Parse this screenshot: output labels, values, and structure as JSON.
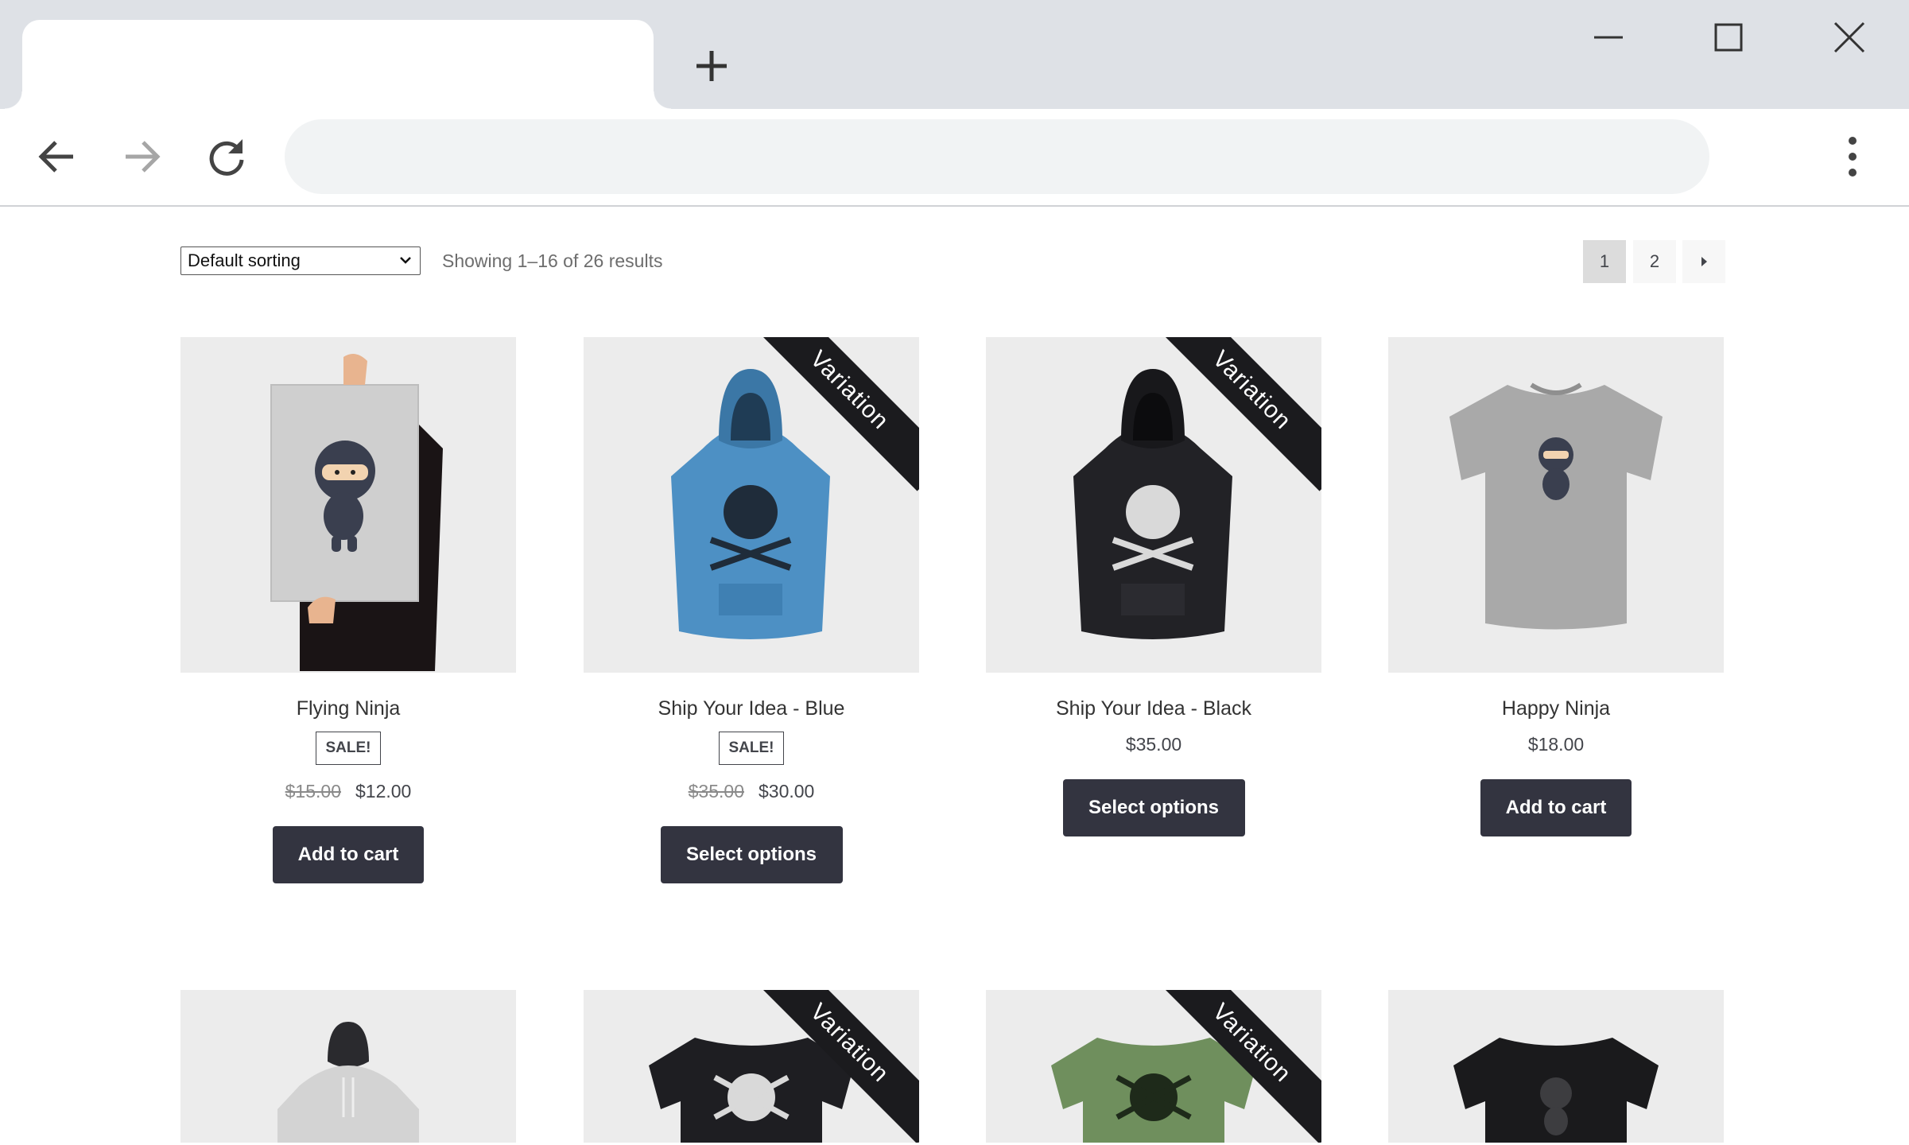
{
  "browser": {
    "icons": {
      "new_tab": "plus-icon",
      "minimize": "minimize-icon",
      "maximize": "maximize-icon",
      "close": "close-icon",
      "back": "back-arrow-icon",
      "forward": "forward-arrow-icon",
      "reload": "reload-icon",
      "menu": "kebab-menu-icon"
    },
    "address": ""
  },
  "shop": {
    "sorting": {
      "selected": "Default sorting"
    },
    "result_count": "Showing 1–16 of 26 results",
    "pagination": {
      "pages": [
        "1",
        "2"
      ],
      "current": "1",
      "next_icon": "next-arrow-icon"
    }
  },
  "products": [
    {
      "name": "Flying Ninja",
      "sale_badge": "SALE!",
      "old_price": "$15.00",
      "price": "$12.00",
      "button": "Add to cart",
      "image": "ninja-poster"
    },
    {
      "name": "Ship Your Idea - Blue",
      "ribbon": "Variation",
      "sale_badge": "SALE!",
      "old_price": "$35.00",
      "price": "$30.00",
      "button": "Select options",
      "image": "blue-hoodie"
    },
    {
      "name": "Ship Your Idea - Black",
      "ribbon": "Variation",
      "price": "$35.00",
      "button": "Select options",
      "image": "black-hoodie"
    },
    {
      "name": "Happy Ninja",
      "price": "$18.00",
      "button": "Add to cart",
      "image": "grey-ninja-tshirt"
    },
    {
      "image": "grey-hoodie"
    },
    {
      "ribbon": "Variation",
      "image": "black-skull-tshirt"
    },
    {
      "ribbon": "Variation",
      "image": "green-skull-tshirt"
    },
    {
      "image": "black-tshirt"
    }
  ],
  "colors": {
    "button_bg": "#333440",
    "ribbon_bg": "#1b1b1e",
    "blue_hoodie": "#4d90c4",
    "green_tshirt": "#6f8f5d"
  }
}
